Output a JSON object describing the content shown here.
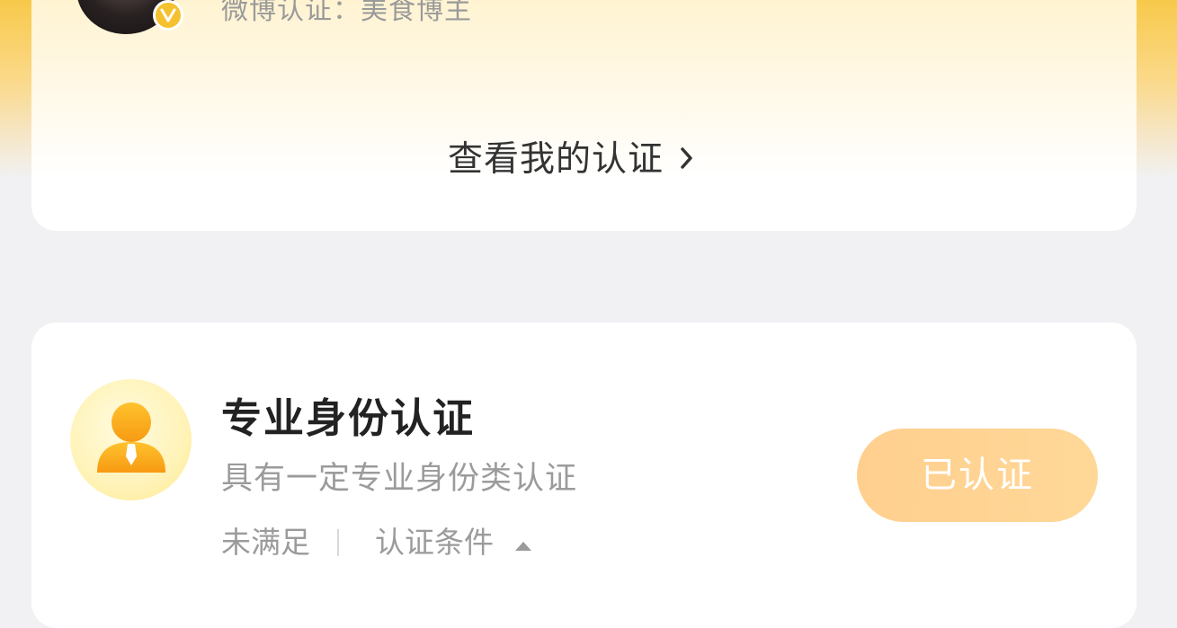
{
  "profile": {
    "certification_text": "微博认证：美食博主",
    "view_link_label": "查看我的认证"
  },
  "professional_card": {
    "title": "专业身份认证",
    "description": "具有一定专业身份类认证",
    "status": "未满足",
    "conditions_label": "认证条件",
    "button_label": "已认证"
  },
  "colors": {
    "accent_gold": "#f5c12e",
    "button_orange": "#ffcf8e",
    "icon_orange": "#f7a21b"
  }
}
